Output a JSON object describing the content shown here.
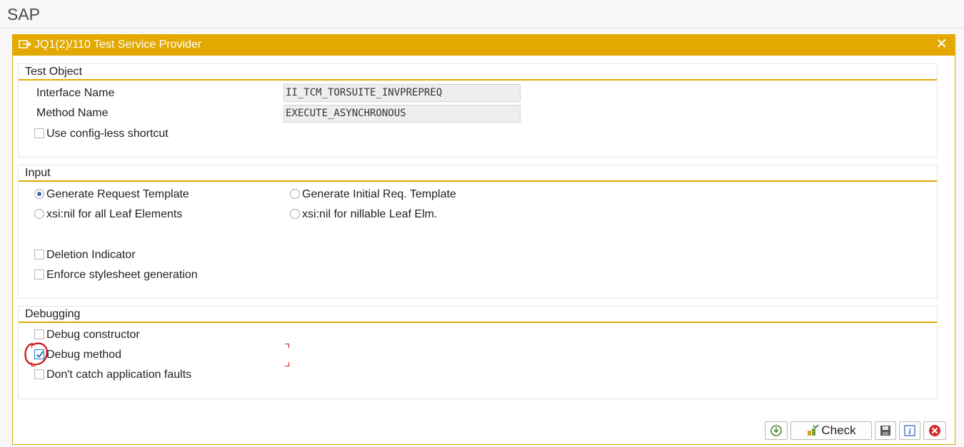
{
  "app": {
    "title": "SAP"
  },
  "dialog": {
    "title": "JQ1(2)/110 Test Service Provider",
    "icon": "dialog-icon",
    "close_icon": "close-icon"
  },
  "test_object": {
    "title": "Test Object",
    "interface_label": "Interface Name",
    "interface_value": "II_TCM_TORSUITE_INVPREPREQ",
    "method_label": "Method Name",
    "method_value": "EXECUTE_ASYNCHRONOUS",
    "config_less_label": "Use config-less shortcut",
    "config_less_checked": false
  },
  "input": {
    "title": "Input",
    "radios": [
      {
        "label": "Generate Request Template",
        "selected": true
      },
      {
        "label": "Generate Initial Req. Template",
        "selected": false
      },
      {
        "label": "xsi:nil for all Leaf Elements",
        "selected": false
      },
      {
        "label": "xsi:nil for nillable Leaf Elm.",
        "selected": false
      }
    ],
    "deletion_label": "Deletion Indicator",
    "stylesheet_label": "Enforce stylesheet generation"
  },
  "debugging": {
    "title": "Debugging",
    "constructor_label": "Debug constructor",
    "method_label": "Debug method",
    "method_checked": true,
    "faults_label": "Don't catch application faults"
  },
  "footer": {
    "check_label": "Check",
    "icons": [
      "execute-icon",
      "check-icon",
      "save-icon",
      "info-icon",
      "cancel-icon"
    ]
  },
  "colors": {
    "accent": "#e3a900",
    "checkbox_checked": "#1e7ac4",
    "annotation": "#d11111"
  }
}
